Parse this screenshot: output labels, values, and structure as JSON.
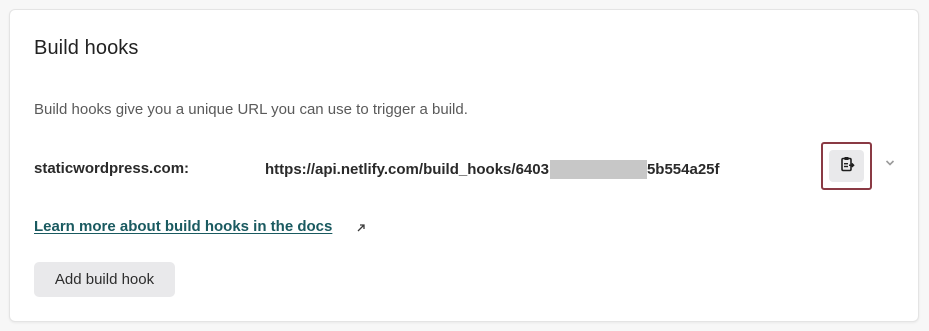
{
  "section": {
    "title": "Build hooks",
    "description": "Build hooks give you a unique URL you can use to trigger a build."
  },
  "hook": {
    "name": "staticwordpress.com:",
    "url_prefix": "https://api.netlify.com/build_hooks/6403",
    "url_suffix": "5b554a25f"
  },
  "docs_link": {
    "label": "Learn more about build hooks in the docs"
  },
  "add_button": {
    "label": "Add build hook"
  },
  "icons": {
    "copy": "clipboard-copy-icon",
    "expand": "chevron-down-icon",
    "external": "external-link-icon"
  },
  "colors": {
    "link": "#1a5a60",
    "highlight_border": "#8a3a44",
    "button_bg": "#e9e9eb"
  }
}
